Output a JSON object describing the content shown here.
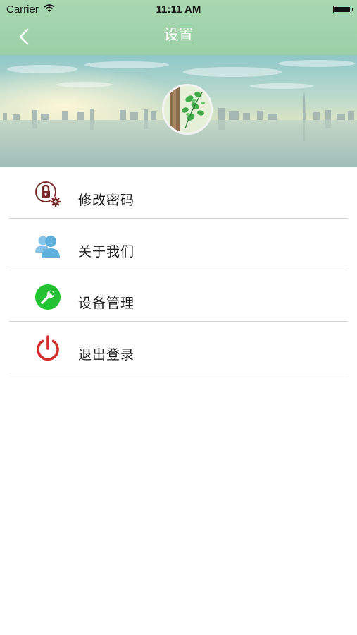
{
  "status_bar": {
    "carrier": "Carrier",
    "time": "11:11 AM"
  },
  "navbar": {
    "title": "设置",
    "back_icon": "chevron-left-icon"
  },
  "banner": {
    "avatar": "plant-photo"
  },
  "menu": {
    "items": [
      {
        "label": "修改密码",
        "icon": "lock-gear-icon",
        "color": "#7a2b2b"
      },
      {
        "label": "关于我们",
        "icon": "users-icon",
        "color": "#5fb0dc"
      },
      {
        "label": "设备管理",
        "icon": "wrench-icon",
        "color": "#22c232"
      },
      {
        "label": "退出登录",
        "icon": "power-icon",
        "color": "#d32a2a"
      }
    ]
  }
}
